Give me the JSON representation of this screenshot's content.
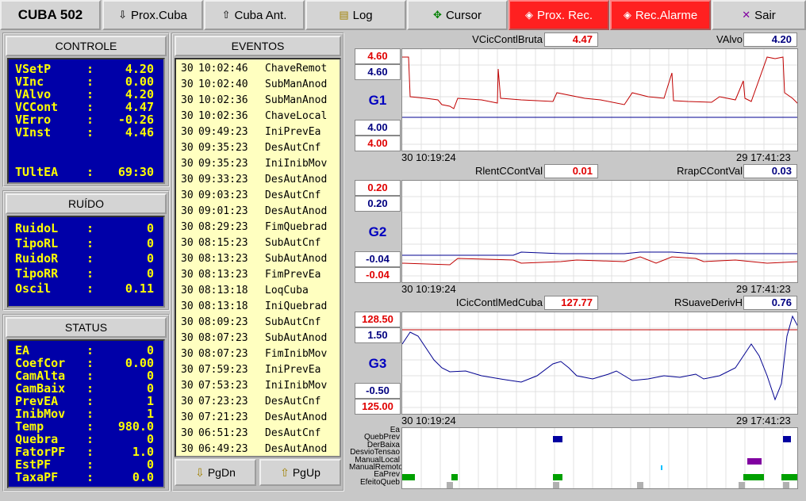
{
  "toolbar": {
    "title": "CUBA 502",
    "buttons": [
      {
        "label": "Prox.Cuba",
        "icon": "next-down-icon",
        "style": "normal"
      },
      {
        "label": "Cuba Ant.",
        "icon": "previous-up-icon",
        "style": "normal"
      },
      {
        "label": "Log",
        "icon": "log-icon",
        "style": "normal"
      },
      {
        "label": "Cursor",
        "icon": "cursor-icon",
        "style": "normal"
      },
      {
        "label": "Prox. Rec.",
        "icon": "next-record-icon",
        "style": "red"
      },
      {
        "label": "Rec.Alarme",
        "icon": "alarm-record-icon",
        "style": "red"
      },
      {
        "label": "Sair",
        "icon": "exit-icon",
        "style": "normal"
      }
    ],
    "small_prefixes": {
      "prox_cuba": "down",
      "cuba_ant": "up"
    }
  },
  "controle": {
    "title": "CONTROLE",
    "rows": [
      {
        "k": "VSetP",
        "v": "4.20"
      },
      {
        "k": "VInc",
        "v": "0.00"
      },
      {
        "k": "VAlvo",
        "v": "4.20"
      },
      {
        "k": "VCCont",
        "v": "4.47"
      },
      {
        "k": "VErro",
        "v": "-0.26"
      },
      {
        "k": "VInst",
        "v": "4.46"
      }
    ],
    "tultea": {
      "k": "TUltEA",
      "v": "69:30"
    }
  },
  "ruido": {
    "title": "RUÍDO",
    "rows": [
      {
        "k": "RuidoL",
        "v": "0"
      },
      {
        "k": "TipoRL",
        "v": "0"
      },
      {
        "k": "RuidoR",
        "v": "0"
      },
      {
        "k": "TipoRR",
        "v": "0"
      },
      {
        "k": "Oscil",
        "v": "0.11"
      }
    ]
  },
  "status": {
    "title": "STATUS",
    "rows": [
      {
        "k": "EA",
        "v": "0"
      },
      {
        "k": "CoefCor",
        "v": "0.00"
      },
      {
        "k": "CamAlta",
        "v": "0"
      },
      {
        "k": "CamBaix",
        "v": "0"
      },
      {
        "k": "PrevEA",
        "v": "1"
      },
      {
        "k": "InibMov",
        "v": "1"
      },
      {
        "k": "Temp",
        "v": "980.0"
      },
      {
        "k": "Quebra",
        "v": "0"
      },
      {
        "k": "FatorPF",
        "v": "1.0"
      },
      {
        "k": "EstPF",
        "v": "0"
      },
      {
        "k": "TaxaPF",
        "v": "0.0"
      }
    ]
  },
  "eventos": {
    "title": "EVENTOS",
    "items": [
      {
        "d": "30",
        "t": "10:02:46",
        "e": "ChaveRemot"
      },
      {
        "d": "30",
        "t": "10:02:40",
        "e": "SubManAnod"
      },
      {
        "d": "30",
        "t": "10:02:36",
        "e": "SubManAnod"
      },
      {
        "d": "30",
        "t": "10:02:36",
        "e": "ChaveLocal"
      },
      {
        "d": "30",
        "t": "09:49:23",
        "e": "IniPrevEa"
      },
      {
        "d": "30",
        "t": "09:35:23",
        "e": "DesAutCnf"
      },
      {
        "d": "30",
        "t": "09:35:23",
        "e": "IniInibMov"
      },
      {
        "d": "30",
        "t": "09:33:23",
        "e": "DesAutAnod"
      },
      {
        "d": "30",
        "t": "09:03:23",
        "e": "DesAutCnf"
      },
      {
        "d": "30",
        "t": "09:01:23",
        "e": "DesAutAnod"
      },
      {
        "d": "30",
        "t": "08:29:23",
        "e": "FimQuebrad"
      },
      {
        "d": "30",
        "t": "08:15:23",
        "e": "SubAutCnf"
      },
      {
        "d": "30",
        "t": "08:13:23",
        "e": "SubAutAnod"
      },
      {
        "d": "30",
        "t": "08:13:23",
        "e": "FimPrevEa"
      },
      {
        "d": "30",
        "t": "08:13:18",
        "e": "LoqCuba"
      },
      {
        "d": "30",
        "t": "08:13:18",
        "e": "IniQuebrad"
      },
      {
        "d": "30",
        "t": "08:09:23",
        "e": "SubAutCnf"
      },
      {
        "d": "30",
        "t": "08:07:23",
        "e": "SubAutAnod"
      },
      {
        "d": "30",
        "t": "08:07:23",
        "e": "FimInibMov"
      },
      {
        "d": "30",
        "t": "07:59:23",
        "e": "IniPrevEa"
      },
      {
        "d": "30",
        "t": "07:53:23",
        "e": "IniInibMov"
      },
      {
        "d": "30",
        "t": "07:23:23",
        "e": "DesAutCnf"
      },
      {
        "d": "30",
        "t": "07:21:23",
        "e": "DesAutAnod"
      },
      {
        "d": "30",
        "t": "06:51:23",
        "e": "DesAutCnf"
      },
      {
        "d": "30",
        "t": "06:49:23",
        "e": "DesAutAnod"
      }
    ],
    "pgdn": "PgDn",
    "pgup": "PgUp"
  },
  "graphs": [
    {
      "name": "G1",
      "left_label": "VCicContlBruta",
      "left_value": "4.47",
      "right_label": "VAlvo",
      "right_value": "4.20",
      "y_red_top": "4.60",
      "y_blue_top": "4.60",
      "y_blue_bot": "4.00",
      "y_red_bot": "4.00",
      "t_start": "30 10:19:24",
      "t_end": "29 17:41:23"
    },
    {
      "name": "G2",
      "left_label": "RlentCContVal",
      "left_value": "0.01",
      "right_label": "RrapCContVal",
      "right_value": "0.03",
      "y_red_top": "0.20",
      "y_blue_top": "0.20",
      "y_blue_bot": "-0.04",
      "y_red_bot": "-0.04",
      "t_start": "30 10:19:24",
      "t_end": "29 17:41:23"
    },
    {
      "name": "G3",
      "left_label": "ICicContlMedCuba",
      "left_value": "127.77",
      "right_label": "RSuaveDerivH",
      "right_value": "0.76",
      "y_red_top": "128.50",
      "y_blue_top": "1.50",
      "y_blue_bot": "-0.50",
      "y_red_bot": "125.00",
      "t_start": "30 10:19:24",
      "t_end": "29 17:41:23"
    }
  ],
  "signals": {
    "labels": [
      "Ea",
      "QuebPrev",
      "DerBaixa",
      "DesvioTensao",
      "ManualLocal",
      "ManualRemoto",
      "EaPrev",
      "EfeitoQueb"
    ]
  },
  "colors": {
    "red": "#ff2020",
    "blue_panel": "#0000a8",
    "yellow_text": "#ffff00",
    "series_red": "#c00000",
    "series_blue": "#000090"
  }
}
